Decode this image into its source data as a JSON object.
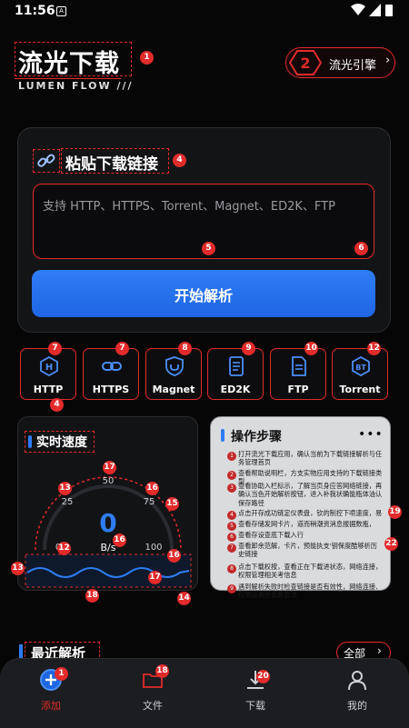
{
  "status_bar": {
    "time": "11:56",
    "notification_icon": "A"
  },
  "header": {
    "app_title": "流光下载",
    "app_subtitle": "LUMEN FLOW ///",
    "engine_number": "2",
    "engine_label": "流光引擎",
    "engine_arrow": "›"
  },
  "paste_card": {
    "title": "粘贴下载链接",
    "input_placeholder": "支持 HTTP、HTTPS、Torrent、Magnet、ED2K、FTP",
    "parse_button": "开始解析"
  },
  "protocols": [
    {
      "label": "HTTP",
      "icon": "http-icon"
    },
    {
      "label": "HTTPS",
      "icon": "https-icon"
    },
    {
      "label": "Magnet",
      "icon": "magnet-icon"
    },
    {
      "label": "ED2K",
      "icon": "ed2k-icon"
    },
    {
      "label": "FTP",
      "icon": "ftp-icon"
    },
    {
      "label": "Torrent",
      "icon": "torrent-icon"
    }
  ],
  "speed_panel": {
    "title": "实时速度",
    "scale_0": "0",
    "scale_25": "25",
    "scale_50": "50",
    "scale_75": "75",
    "scale_100": "100",
    "value": "0",
    "unit": "B/s"
  },
  "steps_panel": {
    "title": "操作步骤",
    "more": "•••",
    "steps": [
      "打开流光下载应用，确认当前为下载链接解析与任务管理首页",
      "查看帮助说明栏，方支实物应用支持的下载链接类型",
      "查看协助入栏标示，了解当页身应答网络链接，再确认当色开始解析按钮，进入补我状确能瓶体油认保存路径",
      "点击开存成功链定仪表盘，钦的制控下喷速度，易",
      "查看存储发网卡片，道而稍潮资消息报据数瓶，",
      "查看存设查底下载入行",
      "查看卸余范解，卡片，预能执支'钥保度酷够析历史链接",
      "点击下载权按，查看正在下载进状态，网络连接，权限管理相关考信息",
      "遇到解析失败时检查链接是否有效性，网络连接、权限设置后重新尝试"
    ]
  },
  "recent": {
    "title": "最近解析",
    "all_label": "全部",
    "all_arrow": "›"
  },
  "nav": [
    {
      "label": "添加",
      "icon": "add-icon",
      "active": true
    },
    {
      "label": "文件",
      "icon": "folder-icon",
      "active": false
    },
    {
      "label": "下载",
      "icon": "download-icon",
      "active": false
    },
    {
      "label": "我的",
      "icon": "profile-icon",
      "active": false
    }
  ],
  "annotations": [
    "1",
    "2",
    "4",
    "5",
    "6",
    "7",
    "7",
    "8",
    "9",
    "10",
    "12",
    "4",
    "13",
    "12",
    "14",
    "17",
    "16",
    "15",
    "16",
    "15",
    "16",
    "17",
    "18",
    "18",
    "13",
    "14",
    "19",
    "22",
    "20",
    "11",
    "18",
    "1",
    "19"
  ],
  "colors": {
    "accent": "#e32b2b",
    "primary_blue": "#2e7cf6",
    "background": "#060607"
  }
}
